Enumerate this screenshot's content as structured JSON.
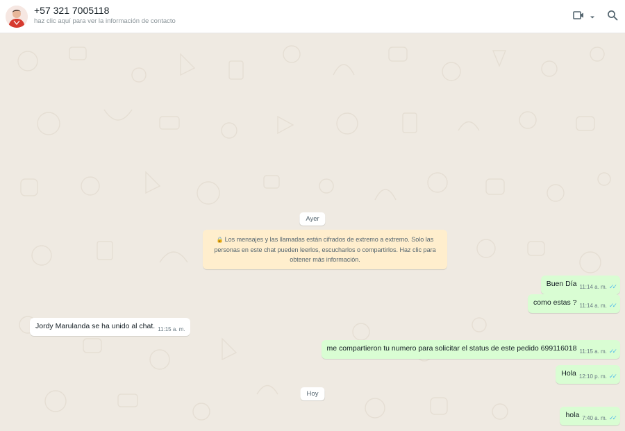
{
  "header": {
    "contact_name": "+57 321 7005118",
    "contact_subtitle": "haz clic aquí para ver la información de contacto",
    "video_icon": "video-camera-icon",
    "dropdown_icon": "chevron-down-icon",
    "search_icon": "search-icon"
  },
  "chat": {
    "date_ayer": "Ayer",
    "encryption_notice": "Los mensajes y las llamadas están cifrados de extremo a extremo. Solo las personas en este chat pueden leerlos, escucharlos o compartirlos. Haz clic para obtener más información.",
    "date_hoy": "Hoy",
    "messages": [
      {
        "direction": "out",
        "text": "Buen Día",
        "time": "11:14 a. m.",
        "status": "read"
      },
      {
        "direction": "out",
        "text": "como estas ?",
        "time": "11:14 a. m.",
        "status": "read"
      },
      {
        "direction": "in",
        "text": "Jordy Marulanda se ha unido al chat.",
        "time": "11:15 a. m."
      },
      {
        "direction": "out",
        "text": "me compartieron tu numero para solicitar el status de este pedido 699116018",
        "time": "11:15 a. m.",
        "status": "read"
      },
      {
        "direction": "out",
        "text": "Hola",
        "time": "12:10 p. m.",
        "status": "read"
      },
      {
        "direction": "out",
        "text": "hola",
        "time": "7:40 a. m.",
        "status": "read"
      }
    ]
  },
  "colors": {
    "outgoing_bubble": "#d9fdd3",
    "incoming_bubble": "#ffffff",
    "encryption_notice_bg": "#ffeecd",
    "chat_background": "#efeae2",
    "read_ticks": "#53bdeb"
  }
}
